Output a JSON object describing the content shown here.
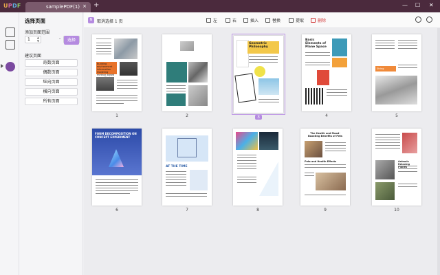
{
  "app": {
    "logo": "UPDF",
    "tab_title": "samplePDF(1)",
    "tab_close": "×",
    "tab_add": "+"
  },
  "window_controls": [
    "—",
    "☐",
    "✕"
  ],
  "panel": {
    "title": "选择页面",
    "range_label": "添加页面范围",
    "from_value": "1",
    "to_value": "1",
    "range_dash": "-",
    "select_button": "选择",
    "suggest_label": "建议页面",
    "suggest_buttons": [
      "奇数页面",
      "偶数页面",
      "纵向页面",
      "横向页面",
      "所有页面"
    ]
  },
  "toolbar": {
    "selected_badge": "N",
    "selected_text": "取消选择 1 页",
    "tools": [
      {
        "label": "左",
        "icon": "rotate-left-icon"
      },
      {
        "label": "右",
        "icon": "rotate-right-icon"
      },
      {
        "label": "插入",
        "icon": "insert-icon"
      },
      {
        "label": "替换",
        "icon": "replace-icon"
      },
      {
        "label": "提取",
        "icon": "extract-icon"
      },
      {
        "label": "删除",
        "icon": "delete-icon"
      }
    ]
  },
  "pages": [
    {
      "number": "1",
      "selected": false
    },
    {
      "number": "2",
      "selected": false
    },
    {
      "number": "3",
      "selected": true
    },
    {
      "number": "4",
      "selected": false
    },
    {
      "number": "5",
      "selected": false
    },
    {
      "number": "6",
      "selected": false
    },
    {
      "number": "7",
      "selected": false
    },
    {
      "number": "8",
      "selected": false
    },
    {
      "number": "9",
      "selected": false
    },
    {
      "number": "10",
      "selected": false
    }
  ],
  "page_texts": {
    "p1_box": "Building environment information modeling method based on multi-view image",
    "p3_title": "Geometric Philosophy",
    "p4_title": "Basic Elements of Plane Space",
    "p5_tag": "String",
    "p6_title": "FORM DECOMPOSITION ON CONCEPT EXPERIMENT",
    "p7_title": "AT THE TIME",
    "p9_title": "The Health and Mood-Boosting Benefits of Pets",
    "p9_sub": "Pets and Health Effects",
    "p10_sub": "Animals Relaxing Planes"
  },
  "colors": {
    "titlebar": "#4b2a3d",
    "accent": "#b58be0",
    "delete": "#d23c3c"
  }
}
